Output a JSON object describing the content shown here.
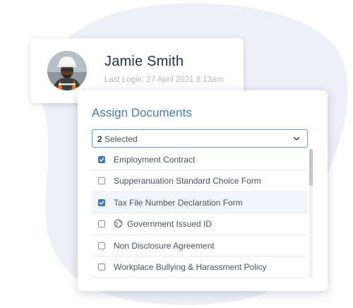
{
  "profile": {
    "name": "Jamie Smith",
    "last_login": "Last Login: 27 April 2021 8:13am"
  },
  "assign": {
    "title": "Assign Documents",
    "dropdown": {
      "count": "2",
      "suffix": "Selected"
    },
    "items": [
      {
        "label": "Employment Contract",
        "checked": true,
        "icon": ""
      },
      {
        "label": "Supperanuation Standard Choice Form",
        "checked": false,
        "icon": ""
      },
      {
        "label": "Tax File Number Declaration Form",
        "checked": true,
        "icon": "",
        "highlighted": true
      },
      {
        "label": "Government Issued ID",
        "checked": false,
        "icon": "globe-icon"
      },
      {
        "label": "Non Disclosure Agreement",
        "checked": false,
        "icon": ""
      },
      {
        "label": "Workplace Bullying & Harassment Policy",
        "checked": false,
        "icon": ""
      }
    ]
  },
  "colors": {
    "accent": "#3d78c0",
    "title": "#4a7cb3",
    "blob": "#eef0f8"
  }
}
